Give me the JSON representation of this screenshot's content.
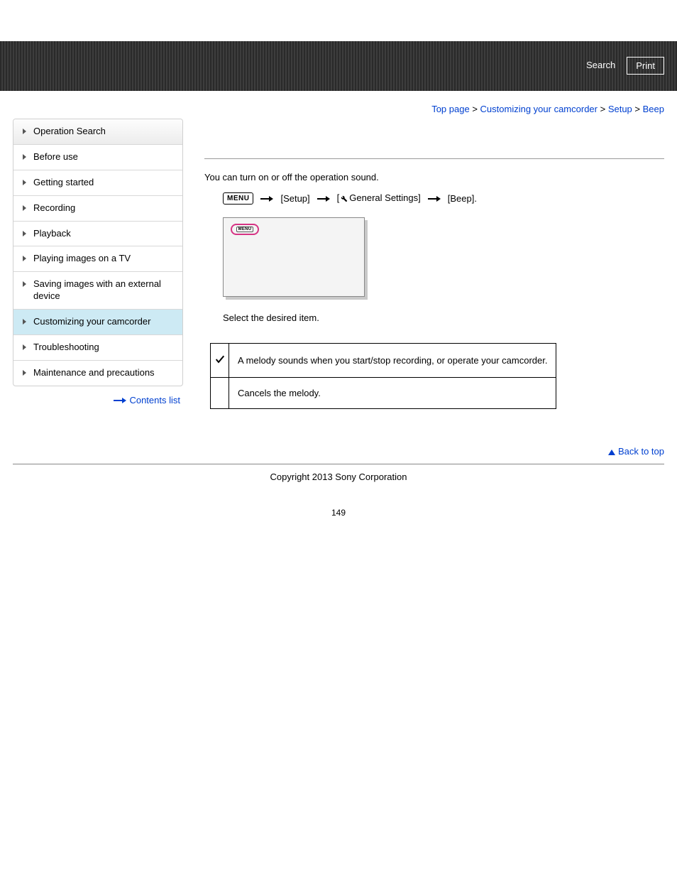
{
  "header": {
    "search_label": "Search",
    "print_label": "Print"
  },
  "breadcrumbs": {
    "items": [
      "Top page",
      "Customizing your camcorder",
      "Setup",
      "Beep"
    ],
    "sep": " > "
  },
  "sidebar": {
    "items": [
      {
        "label": "Operation Search"
      },
      {
        "label": "Before use"
      },
      {
        "label": "Getting started"
      },
      {
        "label": "Recording"
      },
      {
        "label": "Playback"
      },
      {
        "label": "Playing images on a TV"
      },
      {
        "label": "Saving images with an external device"
      },
      {
        "label": "Customizing your camcorder"
      },
      {
        "label": "Troubleshooting"
      },
      {
        "label": "Maintenance and precautions"
      }
    ],
    "active_index": 7,
    "contents_list_label": "Contents list"
  },
  "main": {
    "intro": "You can turn on or off the operation sound.",
    "menu_path": {
      "menu_badge": "MENU",
      "steps": [
        "[Setup]",
        "General Settings]",
        "[Beep]."
      ],
      "general_prefix": "["
    },
    "screenshot_badge": "MENU",
    "instruction": "Select the desired item.",
    "options": [
      {
        "checked": true,
        "desc": "A melody sounds when you start/stop recording, or operate your camcorder."
      },
      {
        "checked": false,
        "desc": "Cancels the melody."
      }
    ]
  },
  "footer": {
    "back_to_top": "Back to top",
    "copyright": "Copyright 2013 Sony Corporation",
    "page_number": "149"
  }
}
